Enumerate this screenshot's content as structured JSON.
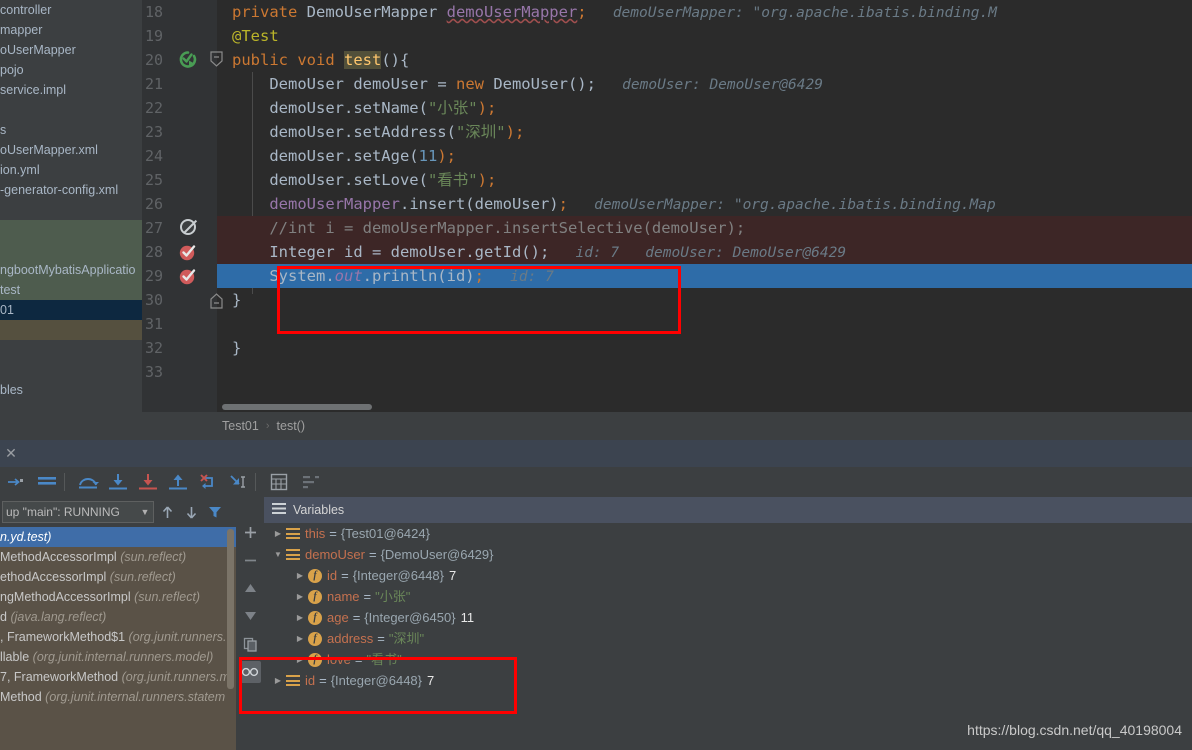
{
  "sidebar": {
    "items": [
      {
        "label": "controller",
        "state": "normal"
      },
      {
        "label": "mapper",
        "state": "normal"
      },
      {
        "label": "oUserMapper",
        "state": "normal"
      },
      {
        "label": "pojo",
        "state": "normal"
      },
      {
        "label": "service.impl",
        "state": "normal"
      },
      {
        "label": "",
        "state": "normal"
      },
      {
        "label": "s",
        "state": "normal"
      },
      {
        "label": "oUserMapper.xml",
        "state": "normal"
      },
      {
        "label": "ion.yml",
        "state": "normal"
      },
      {
        "label": "-generator-config.xml",
        "state": "normal"
      },
      {
        "label": "",
        "state": "normal"
      },
      {
        "label": "",
        "state": "green"
      },
      {
        "label": "",
        "state": "green"
      },
      {
        "label": "ngbootMybatisApplicatio",
        "state": "green"
      },
      {
        "label": "test",
        "state": "green"
      },
      {
        "label": "01",
        "state": "blue"
      },
      {
        "label": "",
        "state": "brown"
      },
      {
        "label": "",
        "state": "normal"
      },
      {
        "label": "",
        "state": "normal"
      },
      {
        "label": "bles",
        "state": "normal"
      }
    ]
  },
  "editor": {
    "lines": [
      {
        "num": "18",
        "tokens": [
          {
            "t": "private ",
            "c": "kw"
          },
          {
            "t": "DemoUserMapper ",
            "c": "typ"
          },
          {
            "t": "demoUserMapper",
            "c": "fldu"
          },
          {
            "t": ";",
            "c": "semi"
          }
        ],
        "hint": "demoUserMapper: \"org.apache.ibatis.binding.M",
        "gutter": "none",
        "bg": "none"
      },
      {
        "num": "19",
        "tokens": [
          {
            "t": "@Test",
            "c": "ann"
          }
        ],
        "hint": "",
        "gutter": "none",
        "bg": "none"
      },
      {
        "num": "20",
        "tokens": [
          {
            "t": "public ",
            "c": "kw"
          },
          {
            "t": "void ",
            "c": "kw"
          },
          {
            "t": "test",
            "c": "mname-hl"
          },
          {
            "t": "(){",
            "c": "plain"
          }
        ],
        "hint": "",
        "gutter": "run",
        "bg": "none"
      },
      {
        "num": "21",
        "tokens": [
          {
            "t": "    DemoUser demoUser ",
            "c": "typ"
          },
          {
            "t": "= ",
            "c": "plain"
          },
          {
            "t": "new ",
            "c": "kw"
          },
          {
            "t": "DemoUser();",
            "c": "typ"
          }
        ],
        "hint": "demoUser: DemoUser@6429",
        "gutter": "none",
        "bg": "none"
      },
      {
        "num": "22",
        "tokens": [
          {
            "t": "    demoUser.setName(",
            "c": "plain"
          },
          {
            "t": "\"小张\"",
            "c": "str"
          },
          {
            "t": ");",
            "c": "semi"
          }
        ],
        "hint": "",
        "gutter": "none",
        "bg": "none"
      },
      {
        "num": "23",
        "tokens": [
          {
            "t": "    demoUser.setAddress(",
            "c": "plain"
          },
          {
            "t": "\"深圳\"",
            "c": "str"
          },
          {
            "t": ");",
            "c": "semi"
          }
        ],
        "hint": "",
        "gutter": "none",
        "bg": "none"
      },
      {
        "num": "24",
        "tokens": [
          {
            "t": "    demoUser.setAge(",
            "c": "plain"
          },
          {
            "t": "11",
            "c": "num"
          },
          {
            "t": ");",
            "c": "semi"
          }
        ],
        "hint": "",
        "gutter": "none",
        "bg": "none"
      },
      {
        "num": "25",
        "tokens": [
          {
            "t": "    demoUser.setLove(",
            "c": "plain"
          },
          {
            "t": "\"看书\"",
            "c": "str"
          },
          {
            "t": ");",
            "c": "semi"
          }
        ],
        "hint": "",
        "gutter": "none",
        "bg": "none"
      },
      {
        "num": "26",
        "tokens": [
          {
            "t": "    demoUserMapper",
            "c": "fld"
          },
          {
            "t": ".insert(demoUser)",
            "c": "plain"
          },
          {
            "t": ";",
            "c": "semi"
          }
        ],
        "hint": "demoUserMapper: \"org.apache.ibatis.binding.Map",
        "gutter": "none",
        "bg": "none"
      },
      {
        "num": "27",
        "tokens": [
          {
            "t": "    //int i = demoUserMapper.insertSelective(demoUser);",
            "c": "cmt"
          }
        ],
        "hint": "",
        "gutter": "bp-disabled",
        "bg": "err"
      },
      {
        "num": "28",
        "tokens": [
          {
            "t": "    Integer id = demoUser.getId();",
            "c": "plain"
          }
        ],
        "hint": "id: 7   demoUser: DemoUser@6429",
        "gutter": "bp-red",
        "bg": "err"
      },
      {
        "num": "29",
        "tokens": [
          {
            "t": "    System.",
            "c": "plain"
          },
          {
            "t": "out",
            "c": "sout"
          },
          {
            "t": ".println(id)",
            "c": "plain"
          },
          {
            "t": ";",
            "c": "semi"
          }
        ],
        "hint": "id: 7",
        "gutter": "bp-red",
        "bg": "sel"
      },
      {
        "num": "30",
        "tokens": [
          {
            "t": "}",
            "c": "plain"
          }
        ],
        "hint": "",
        "gutter": "fold",
        "bg": "none",
        "noindent": true
      },
      {
        "num": "31",
        "tokens": [],
        "hint": "",
        "gutter": "none",
        "bg": "none"
      },
      {
        "num": "32",
        "tokens": [
          {
            "t": "}",
            "c": "plain"
          }
        ],
        "hint": "",
        "gutter": "none",
        "bg": "none",
        "noindent": true,
        "outdent": true
      },
      {
        "num": "33",
        "tokens": [],
        "hint": "",
        "gutter": "none",
        "bg": "none"
      }
    ]
  },
  "breadcrumb": {
    "class_name": "Test01",
    "separator": "›",
    "method_name": "test()"
  },
  "debug_toolbar": {
    "buttons": [
      {
        "name": "show-execution-point-icon",
        "glyph": "→"
      },
      {
        "name": "evaluate-lines-icon",
        "glyph": "≡"
      },
      {
        "name": "step-over-icon",
        "glyph": "step-over"
      },
      {
        "name": "step-into-icon",
        "glyph": "step-into"
      },
      {
        "name": "force-step-into-icon",
        "glyph": "force-step-into"
      },
      {
        "name": "step-out-icon",
        "glyph": "step-out"
      },
      {
        "name": "drop-frame-icon",
        "glyph": "drop-frame"
      },
      {
        "name": "run-to-cursor-icon",
        "glyph": "run-to-cursor"
      },
      {
        "name": "evaluate-expression-icon",
        "glyph": "calculator"
      },
      {
        "name": "layout-settings-icon",
        "glyph": "layout"
      }
    ]
  },
  "frames": {
    "thread_selector": "up \"main\": RUNNING",
    "buttons": [
      {
        "name": "frame-up-button",
        "glyph": "↑"
      },
      {
        "name": "frame-down-button",
        "glyph": "↓"
      },
      {
        "name": "filter-frames-button",
        "glyph": "filter"
      }
    ],
    "rows": [
      {
        "method": "n.yd.test)",
        "pkg": "",
        "selected": true
      },
      {
        "method": "MethodAccessorImpl ",
        "pkg": "(sun.reflect)",
        "selected": false
      },
      {
        "method": "ethodAccessorImpl ",
        "pkg": "(sun.reflect)",
        "selected": false
      },
      {
        "method": "ngMethodAccessorImpl ",
        "pkg": "(sun.reflect)",
        "selected": false
      },
      {
        "method": "d ",
        "pkg": "(java.lang.reflect)",
        "selected": false
      },
      {
        "method": ", FrameworkMethod$1 ",
        "pkg": "(org.junit.runners.",
        "selected": false
      },
      {
        "method": "llable ",
        "pkg": "(org.junit.internal.runners.model)",
        "selected": false
      },
      {
        "method": "7, FrameworkMethod ",
        "pkg": "(org.junit.runners.m",
        "selected": false
      },
      {
        "method": "Method ",
        "pkg": "(org.junit.internal.runners.statem",
        "selected": false
      },
      {
        "method": "",
        "pkg": "",
        "selected": false
      }
    ]
  },
  "variables": {
    "title": "Variables",
    "side_buttons": [
      {
        "name": "add-watch-button",
        "glyph": "+"
      },
      {
        "name": "remove-watch-button",
        "glyph": "−"
      },
      {
        "name": "move-watch-up-button",
        "glyph": "▲"
      },
      {
        "name": "move-watch-down-button",
        "glyph": "▼"
      },
      {
        "name": "copy-value-button",
        "glyph": "copy"
      },
      {
        "name": "inspect-button",
        "glyph": "oo"
      }
    ],
    "rows": [
      {
        "indent": 0,
        "arrow": "▶",
        "icon": "group",
        "name": "this",
        "eq": "=",
        "ref": "{Test01@6424}",
        "str": "",
        "num": ""
      },
      {
        "indent": 0,
        "arrow": "▼",
        "icon": "group",
        "name": "demoUser",
        "eq": "=",
        "ref": "{DemoUser@6429}",
        "str": "",
        "num": ""
      },
      {
        "indent": 1,
        "arrow": "▶",
        "icon": "field",
        "name": "id",
        "eq": "=",
        "ref": "{Integer@6448}",
        "str": "",
        "num": "7"
      },
      {
        "indent": 1,
        "arrow": "▶",
        "icon": "field",
        "name": "name",
        "eq": "=",
        "ref": "",
        "str": "\"小张\"",
        "num": ""
      },
      {
        "indent": 1,
        "arrow": "▶",
        "icon": "field",
        "name": "age",
        "eq": "=",
        "ref": "{Integer@6450}",
        "str": "",
        "num": "11"
      },
      {
        "indent": 1,
        "arrow": "▶",
        "icon": "field",
        "name": "address",
        "eq": "=",
        "ref": "",
        "str": "\"深圳\"",
        "num": ""
      },
      {
        "indent": 1,
        "arrow": "▶",
        "icon": "field",
        "name": "love",
        "eq": "=",
        "ref": "",
        "str": "\"看书\"",
        "num": ""
      },
      {
        "indent": 0,
        "arrow": "▶",
        "icon": "group",
        "name": "id",
        "eq": "=",
        "ref": "{Integer@6448}",
        "str": "",
        "num": "7"
      }
    ]
  },
  "watermark": {
    "url": "https://blog.csdn.net/qq_40198004"
  },
  "colors": {
    "editor_bg": "#2b2b2b",
    "gutter_bg": "#313335",
    "selection_blue": "#2e6ca8",
    "error_line_bg": "#3d2626",
    "panel_bg": "#3c3f41",
    "frames_bg": "#5a5247",
    "annotation_red": "#ff0000",
    "keyword_orange": "#cc7832",
    "string_green": "#6a8759",
    "field_purple": "#9876aa",
    "number_blue": "#6897bb",
    "method_yellow": "#ffc66d",
    "variable_name": "#c5714f"
  }
}
